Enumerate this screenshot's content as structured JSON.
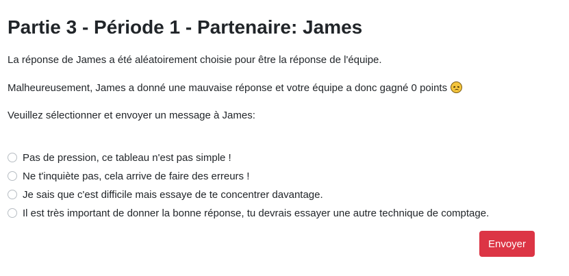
{
  "title": "Partie 3 - Période 1 - Partenaire: James",
  "paragraphs": {
    "chosen": "La réponse de James a été aléatoirement choisie pour être la réponse de l'équipe.",
    "result": "Malheureusement, James a donné une mauvaise réponse et votre équipe a donc gagné 0 points",
    "result_emoji": "disappointed-face-icon",
    "instruction": "Veuillez sélectionner et envoyer un message à James:"
  },
  "options": [
    "Pas de pression, ce tableau n'est pas simple !",
    "Ne t'inquiète pas, cela arrive de faire des erreurs !",
    "Je sais que c'est difficile mais essaye de te concentrer davantage.",
    "Il est très important de donner la bonne réponse, tu devrais essayer une autre technique de comptage."
  ],
  "submit_label": "Envoyer",
  "colors": {
    "button": "#dc3545",
    "text": "#212529"
  }
}
